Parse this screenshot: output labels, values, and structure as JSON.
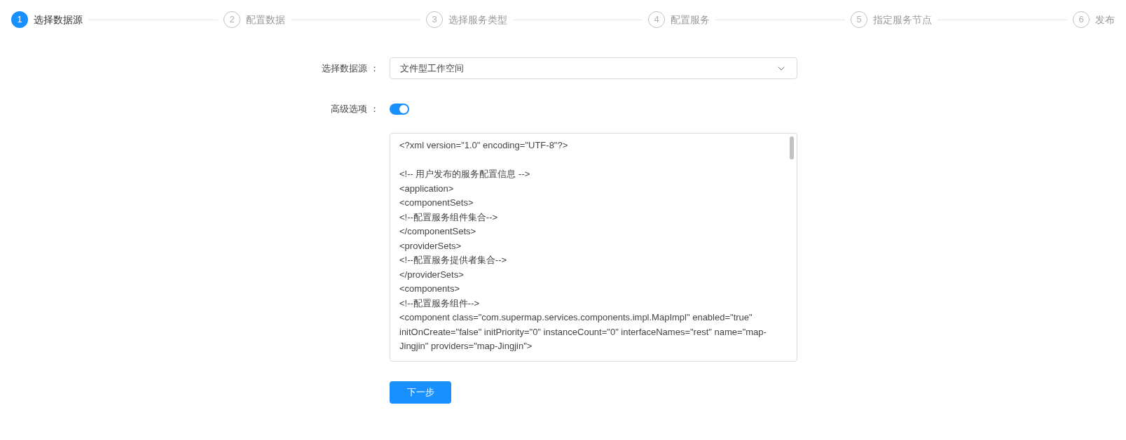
{
  "steps": [
    {
      "number": "1",
      "label": "选择数据源",
      "selected": true
    },
    {
      "number": "2",
      "label": "配置数据",
      "selected": false
    },
    {
      "number": "3",
      "label": "选择服务类型",
      "selected": false
    },
    {
      "number": "4",
      "label": "配置服务",
      "selected": false
    },
    {
      "number": "5",
      "label": "指定服务节点",
      "selected": false
    },
    {
      "number": "6",
      "label": "发布",
      "selected": false
    }
  ],
  "form": {
    "data_source": {
      "label": "选择数据源 ：",
      "value": "文件型工作空间"
    },
    "advanced": {
      "label": "高级选项 ：",
      "on": true
    },
    "config_editor": {
      "value": "<?xml version=\"1.0\" encoding=\"UTF-8\"?>\n\n<!-- 用户发布的服务配置信息 -->\n<application>\n<componentSets>\n<!--配置服务组件集合-->\n</componentSets>\n<providerSets>\n<!--配置服务提供者集合-->\n</providerSets>\n<components>\n<!--配置服务组件-->\n<component class=\"com.supermap.services.components.impl.MapImpl\" enabled=\"true\" initOnCreate=\"false\" initPriority=\"0\" instanceCount=\"0\" interfaceNames=\"rest\" name=\"map-Jingjin\" providers=\"map-Jingjin\">"
    },
    "next_button": "下一步"
  }
}
